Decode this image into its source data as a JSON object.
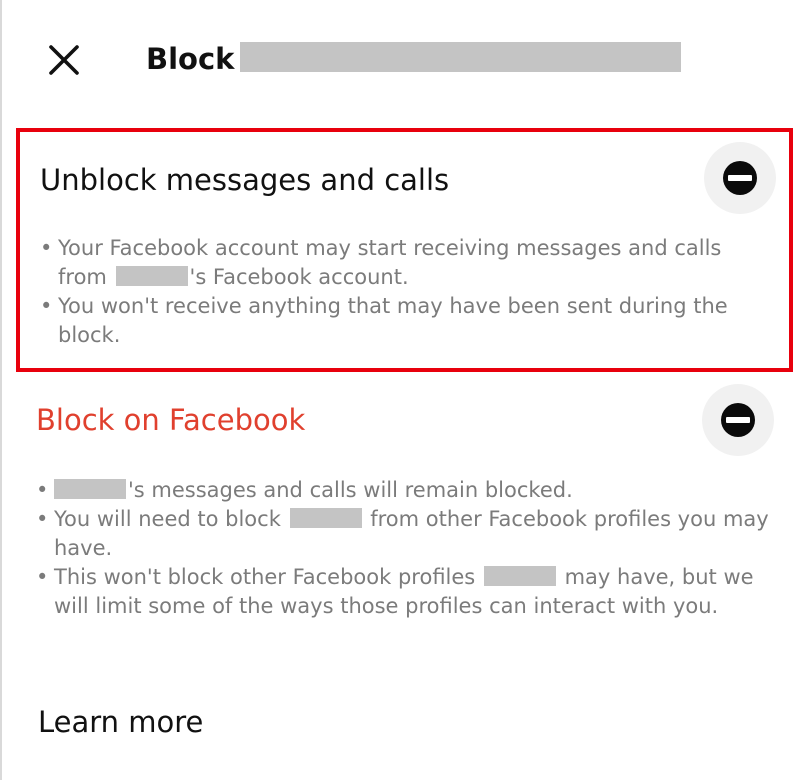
{
  "header": {
    "title": "Block",
    "close_icon": "close-icon"
  },
  "unblock_section": {
    "title": "Unblock messages and calls",
    "action_icon": "minus-circle-icon",
    "bullets": [
      {
        "before": "Your Facebook account may start receiving messages and calls from ",
        "after": "'s Facebook account."
      },
      {
        "before": "You won't receive anything that may have been sent during the block.",
        "after": ""
      }
    ]
  },
  "block_section": {
    "title": "Block on Facebook",
    "action_icon": "minus-circle-icon",
    "bullets": [
      {
        "before": "",
        "after": "'s messages and calls will remain blocked."
      },
      {
        "before": "You will need to block ",
        "after": " from other Facebook profiles you may have."
      },
      {
        "before": "This won't block other Facebook profiles ",
        "after": " may have, but we will limit some of the ways those profiles can interact with you."
      }
    ]
  },
  "footer": {
    "learn_more": "Learn more"
  },
  "colors": {
    "highlight_border": "#e8000d",
    "block_title": "#e0402e",
    "bullet_text": "#7b7b7b",
    "redaction": "#c4c4c4"
  }
}
